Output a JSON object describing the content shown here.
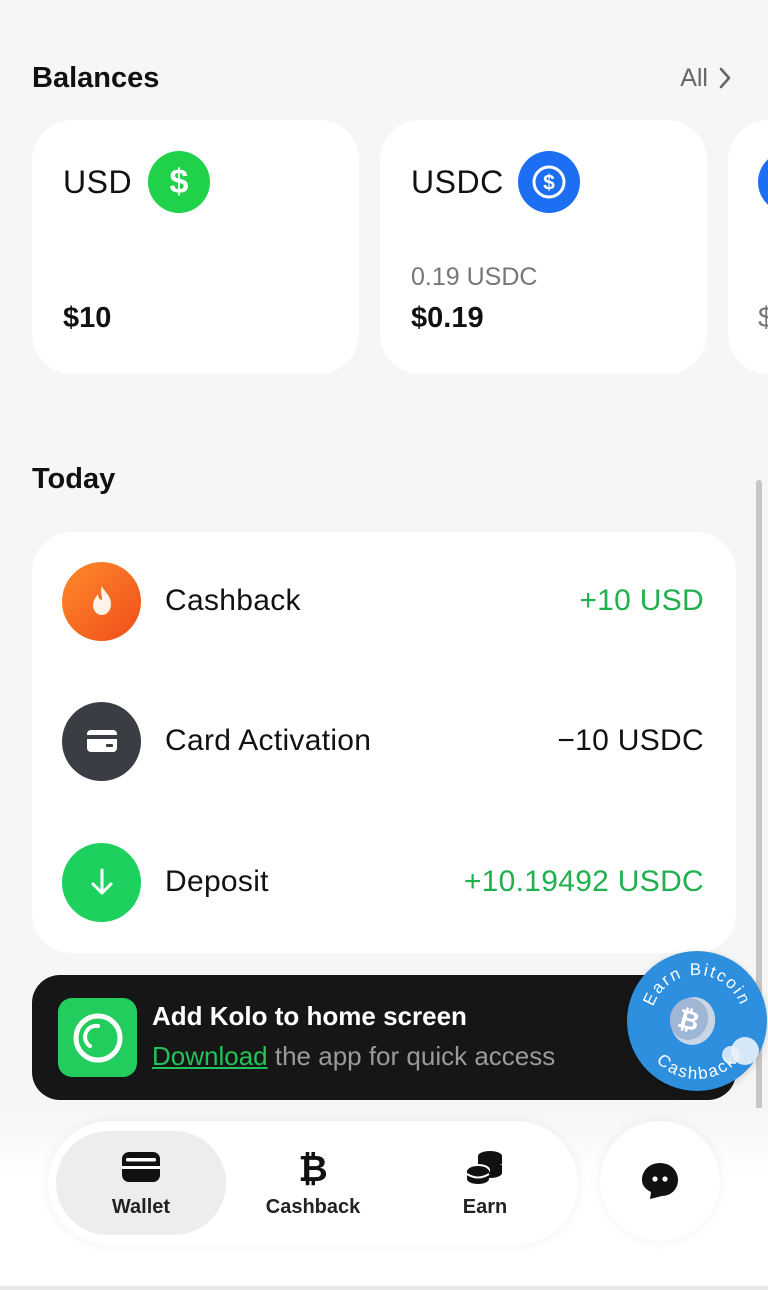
{
  "balances": {
    "title": "Balances",
    "all_label": "All",
    "cards": [
      {
        "name": "USD",
        "sub": "",
        "amount": "$10",
        "icon": "dollar-coin-icon",
        "color": "#1fd24a"
      },
      {
        "name": "USDC",
        "sub": "0.19 USDC",
        "amount": "$0.19",
        "icon": "usdc-coin-icon",
        "color": "#1c6ef2"
      },
      {
        "name": "",
        "sub": "",
        "amount": "$",
        "icon": "coin-icon",
        "color": "#1c6ef2"
      }
    ]
  },
  "today": {
    "title": "Today",
    "transactions": [
      {
        "label": "Cashback",
        "amount": "+10 USD",
        "icon": "flame-icon",
        "positive": true
      },
      {
        "label": "Card Activation",
        "amount": "−10 USDC",
        "icon": "card-icon",
        "positive": false
      },
      {
        "label": "Deposit",
        "amount": "+10.19492 USDC",
        "icon": "arrow-down-icon",
        "positive": true
      }
    ]
  },
  "promo": {
    "title": "Add Kolo to home screen",
    "link": "Download",
    "rest": " the app for quick access",
    "badge_top": "Earn Bitcoin",
    "badge_bottom": "Cashback"
  },
  "nav": {
    "items": [
      {
        "label": "Wallet",
        "icon": "wallet-icon",
        "active": true
      },
      {
        "label": "Cashback",
        "icon": "bitcoin-icon",
        "active": false
      },
      {
        "label": "Earn",
        "icon": "coins-stack-icon",
        "active": false
      }
    ],
    "chat_icon": "chat-icon"
  },
  "colors": {
    "positive": "#20b04e",
    "accent_green": "#22cc5d",
    "usdc_blue": "#1c6ef2"
  }
}
